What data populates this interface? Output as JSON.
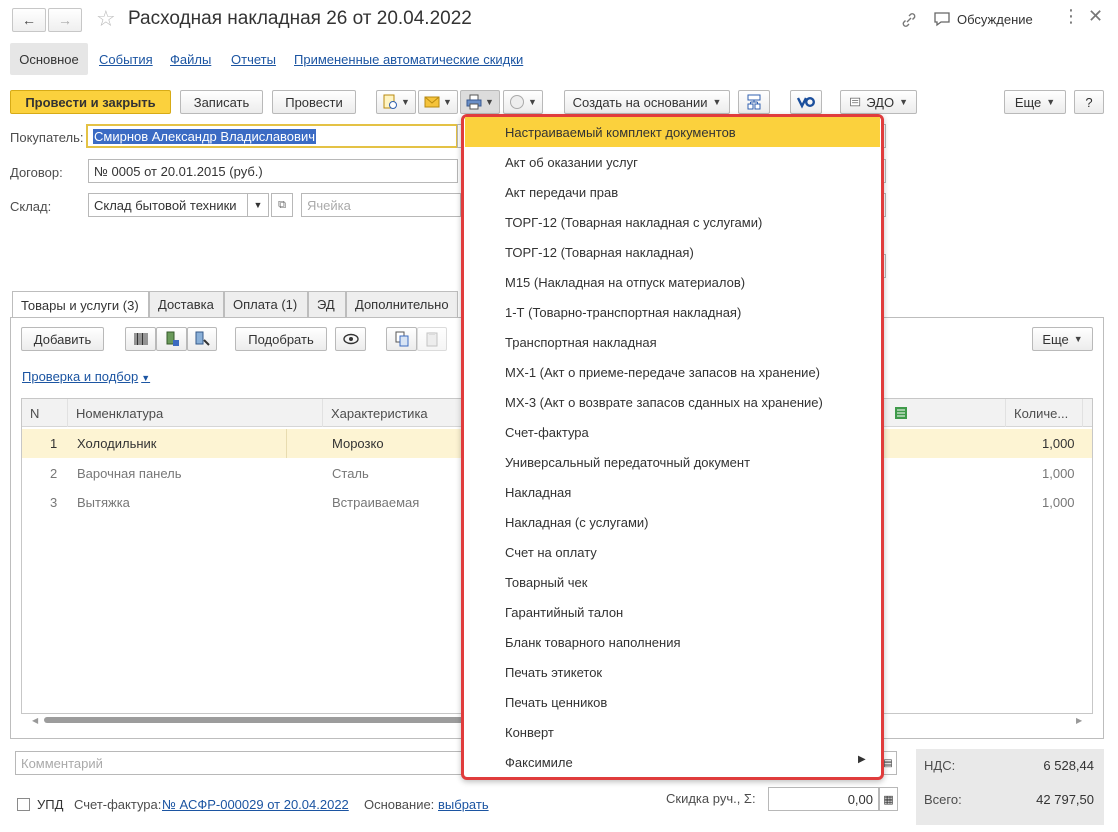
{
  "window": {
    "title": "Расходная накладная 26 от 20.04.2022",
    "discussion_label": "Обсуждение"
  },
  "top_tabs": [
    "Основное",
    "События",
    "Файлы",
    "Отчеты",
    "Примененные автоматические скидки"
  ],
  "toolbar": {
    "post_close": "Провести и закрыть",
    "save": "Записать",
    "post": "Провести",
    "create_based": "Создать на основании",
    "edo": "ЭДО",
    "more": "Еще",
    "help": "?"
  },
  "form": {
    "buyer_label": "Покупатель:",
    "buyer_value": "Смирнов Александр Владиславович",
    "contract_label": "Договор:",
    "contract_value": "№ 0005 от 20.01.2015 (руб.)",
    "warehouse_label": "Склад:",
    "warehouse_value": "Склад бытовой техники",
    "cell_placeholder": "Ячейка"
  },
  "section_tabs": [
    "Товары и услуги (3)",
    "Доставка",
    "Оплата (1)",
    "ЭД",
    "Дополнительно"
  ],
  "table_toolbar": {
    "add": "Добавить",
    "pick": "Подобрать",
    "more": "Еще",
    "check_link": "Проверка и подбор"
  },
  "table": {
    "columns": [
      "N",
      "Номенклатура",
      "Характеристика",
      "Количе..."
    ],
    "rows": [
      {
        "n": "1",
        "name": "Холодильник",
        "char": "Морозко",
        "qty": "1,000"
      },
      {
        "n": "2",
        "name": "Варочная панель",
        "char": "Сталь",
        "qty": "1,000"
      },
      {
        "n": "3",
        "name": "Вытяжка",
        "char": "Встраиваемая",
        "qty": "1,000"
      }
    ]
  },
  "print_menu": {
    "items": [
      "Настраиваемый комплект документов",
      "Акт об оказании услуг",
      "Акт передачи прав",
      "ТОРГ-12 (Товарная накладная с услугами)",
      "ТОРГ-12 (Товарная накладная)",
      "М15 (Накладная на отпуск материалов)",
      "1-Т (Товарно-транспортная накладная)",
      "Транспортная накладная",
      "МХ-1 (Акт о приеме-передаче запасов на хранение)",
      "МХ-3 (Акт о возврате запасов сданных на хранение)",
      "Счет-фактура",
      "Универсальный передаточный документ",
      "Накладная",
      "Накладная (с услугами)",
      "Счет на оплату",
      "Товарный чек",
      "Гарантийный талон",
      "Бланк товарного наполнения",
      "Печать этикеток",
      "Печать ценников",
      "Конверт",
      "Факсимиле"
    ],
    "highlight_color": "#fbd13d",
    "border_color": "#e03c3c"
  },
  "footer": {
    "comment_placeholder": "Комментарий",
    "upd_label": "УПД",
    "invoice_label": "Счет-фактура:",
    "invoice_link": "№ АСФР-000029  от 20.04.2022",
    "basis_label": "Основание:",
    "basis_link": "выбрать",
    "discount_label": "Скидка руч., Σ:",
    "discount_value": "0,00",
    "vat_label": "НДС:",
    "vat_value": "6 528,44",
    "total_label": "Всего:",
    "total_value": "42 797,50"
  },
  "colors": {
    "accent_yellow": "#fbd13d",
    "link_blue": "#1c55a2",
    "row_selected": "#fdf4d3"
  }
}
